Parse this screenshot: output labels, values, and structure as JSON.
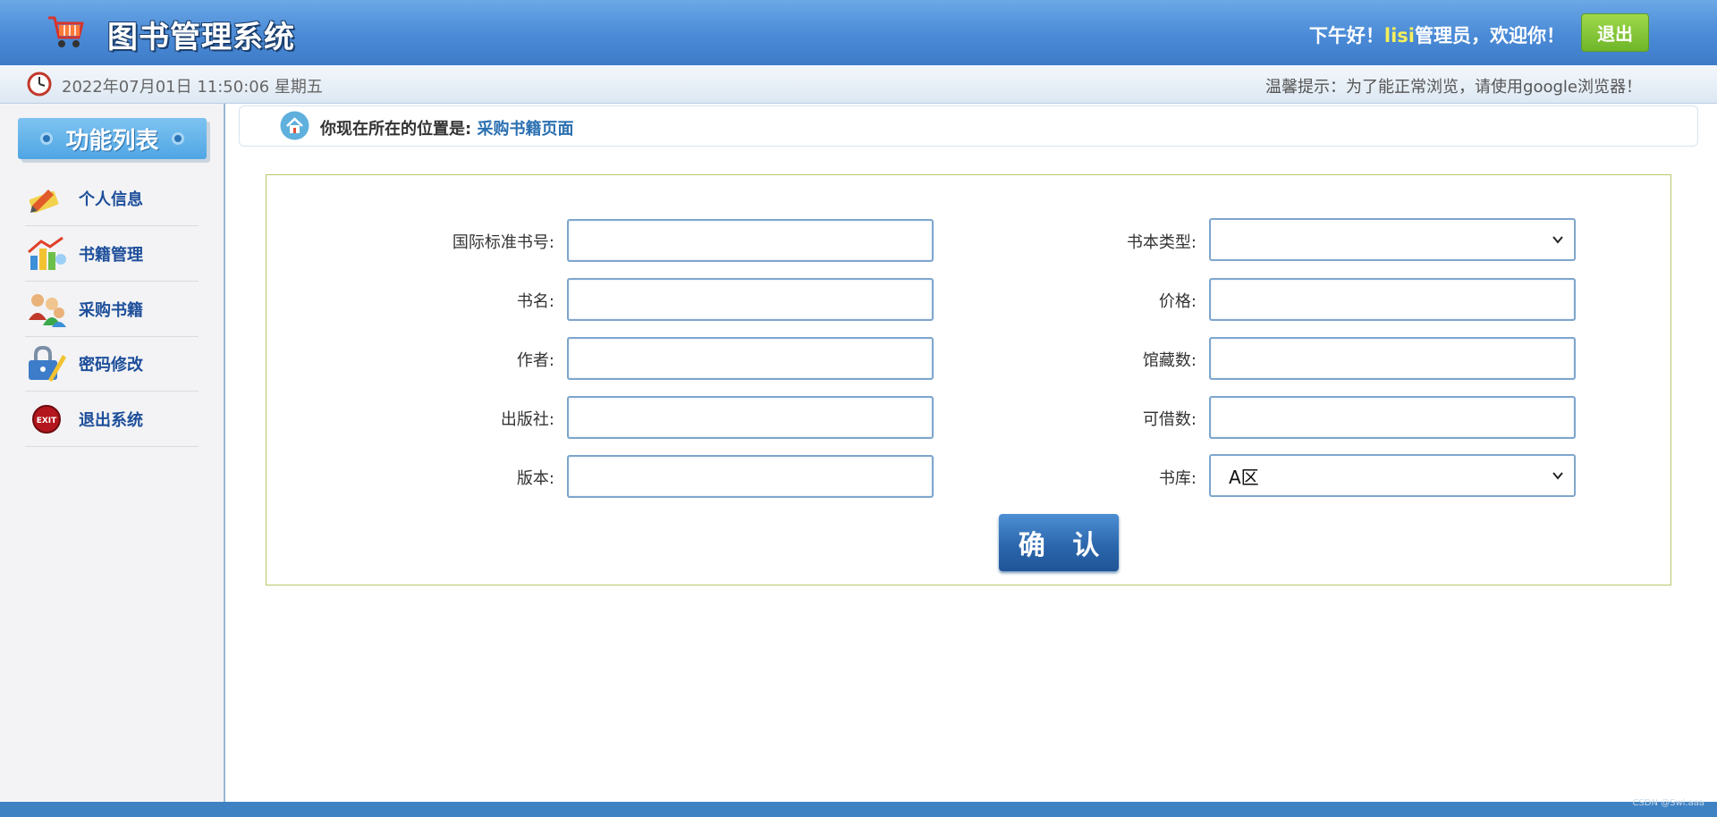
{
  "header": {
    "title": "图书管理系统",
    "greeting_prefix": "下午好！",
    "username": "lisi",
    "greeting_suffix": "管理员，欢迎你！",
    "logout_label": "退出"
  },
  "infobar": {
    "datetime": "2022年07月01日 11:50:06 星期五",
    "tip": "温馨提示：为了能正常浏览，请使用google浏览器！"
  },
  "sidebar": {
    "heading": "功能列表",
    "items": [
      {
        "label": "个人信息",
        "icon": "pencil-note-icon"
      },
      {
        "label": "书籍管理",
        "icon": "books-chart-icon"
      },
      {
        "label": "采购书籍",
        "icon": "users-group-icon"
      },
      {
        "label": "密码修改",
        "icon": "lock-pencil-icon"
      },
      {
        "label": "退出系统",
        "icon": "exit-icon"
      }
    ]
  },
  "breadcrumb": {
    "prefix": "你现在所在的位置是:",
    "current": "采购书籍页面"
  },
  "form": {
    "isbn_label": "国际标准书号:",
    "isbn_value": "",
    "name_label": "书名:",
    "name_value": "",
    "author_label": "作者:",
    "author_value": "",
    "publisher_label": "出版社:",
    "publisher_value": "",
    "edition_label": "版本:",
    "edition_value": "",
    "type_label": "书本类型:",
    "type_value": "",
    "price_label": "价格:",
    "price_value": "",
    "collection_label": "馆藏数:",
    "collection_value": "",
    "borrowable_label": "可借数:",
    "borrowable_value": "",
    "library_label": "书库:",
    "library_value": "A区",
    "submit_label": "确 认"
  },
  "footer": {
    "watermark": "CSDN @Swi.aaa"
  },
  "colors": {
    "header_blue": "#4a8ad6",
    "link_blue": "#2a6fb1",
    "logout_green": "#7fc63a",
    "username_yellow": "#f6f05a",
    "panel_border": "#b9c96a"
  }
}
